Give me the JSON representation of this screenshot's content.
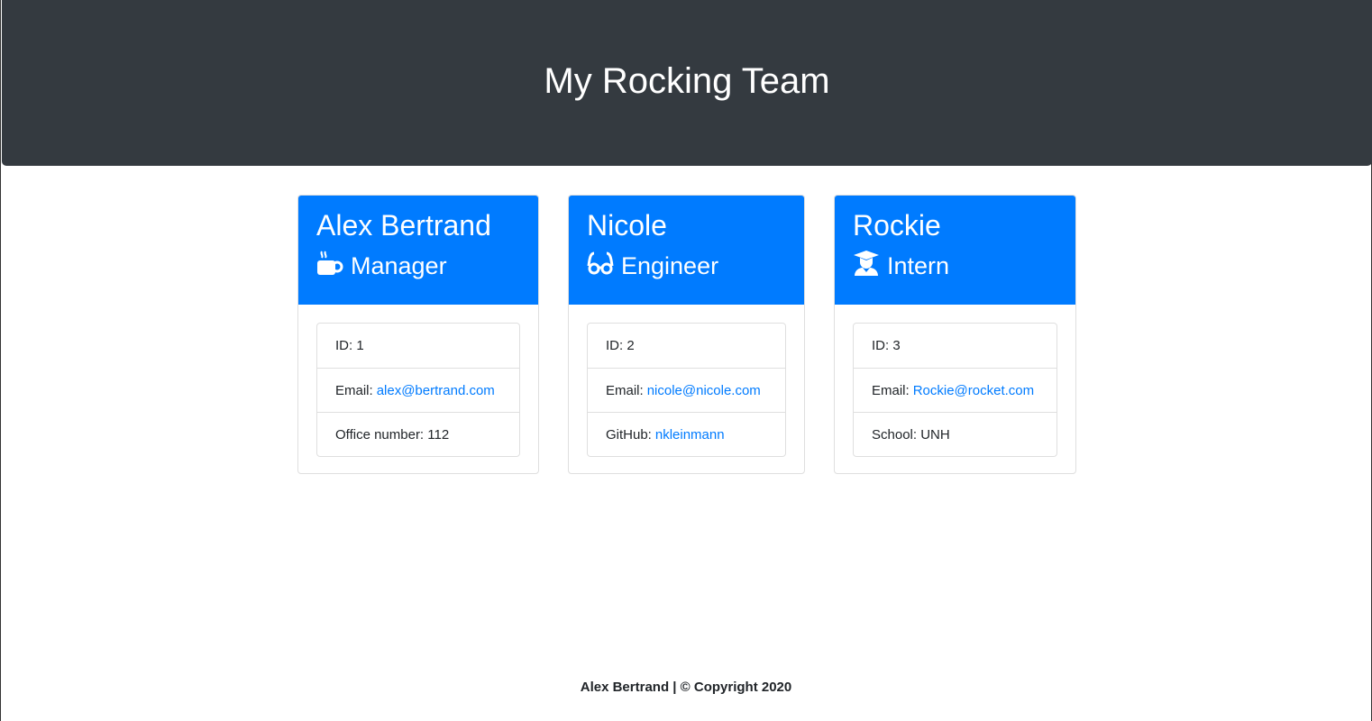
{
  "header": {
    "title": "My Rocking Team"
  },
  "cards": [
    {
      "name": "Alex Bertrand",
      "role": "Manager",
      "icon": "coffee-icon",
      "id_label": "ID: 1",
      "email_label": "Email:",
      "email": "alex@bertrand.com",
      "extra_label": "Office number: 112",
      "extra_link": ""
    },
    {
      "name": "Nicole",
      "role": "Engineer",
      "icon": "glasses-icon",
      "id_label": "ID: 2",
      "email_label": "Email:",
      "email": "nicole@nicole.com",
      "extra_label": "GitHub:",
      "extra_link": "nkleinmann"
    },
    {
      "name": "Rockie",
      "role": "Intern",
      "icon": "graduate-icon",
      "id_label": "ID: 3",
      "email_label": "Email:",
      "email": "Rockie@rocket.com",
      "extra_label": "School: UNH",
      "extra_link": ""
    }
  ],
  "footer": {
    "text": "Alex Bertrand | © Copyright 2020"
  },
  "colors": {
    "header": "#343a40",
    "primary": "#007bff"
  }
}
